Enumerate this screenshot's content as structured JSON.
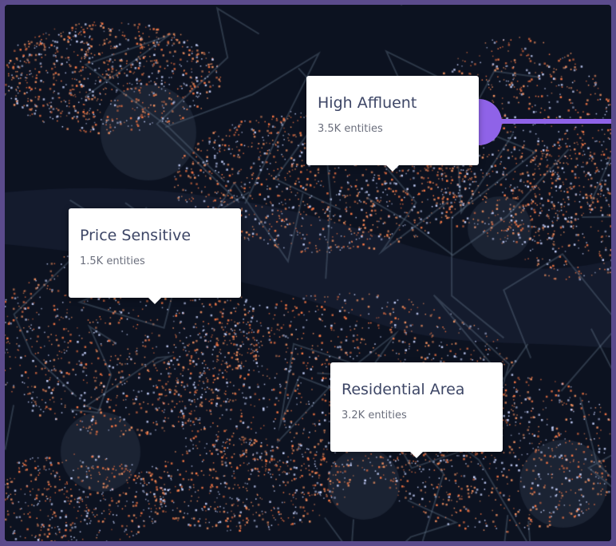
{
  "map": {
    "background": "#0c1220",
    "density_colors": [
      "#ff7a45",
      "#c9d4ff",
      "#f09060"
    ],
    "accent": "#8f63e8"
  },
  "labels": {
    "high_affluent": {
      "title": "High Affluent",
      "count": "3.5K entities"
    },
    "price_sensitive": {
      "title": "Price Sensitive",
      "count": "1.5K entities"
    },
    "residential": {
      "title": "Residential Area",
      "count": "3.2K entities"
    }
  }
}
